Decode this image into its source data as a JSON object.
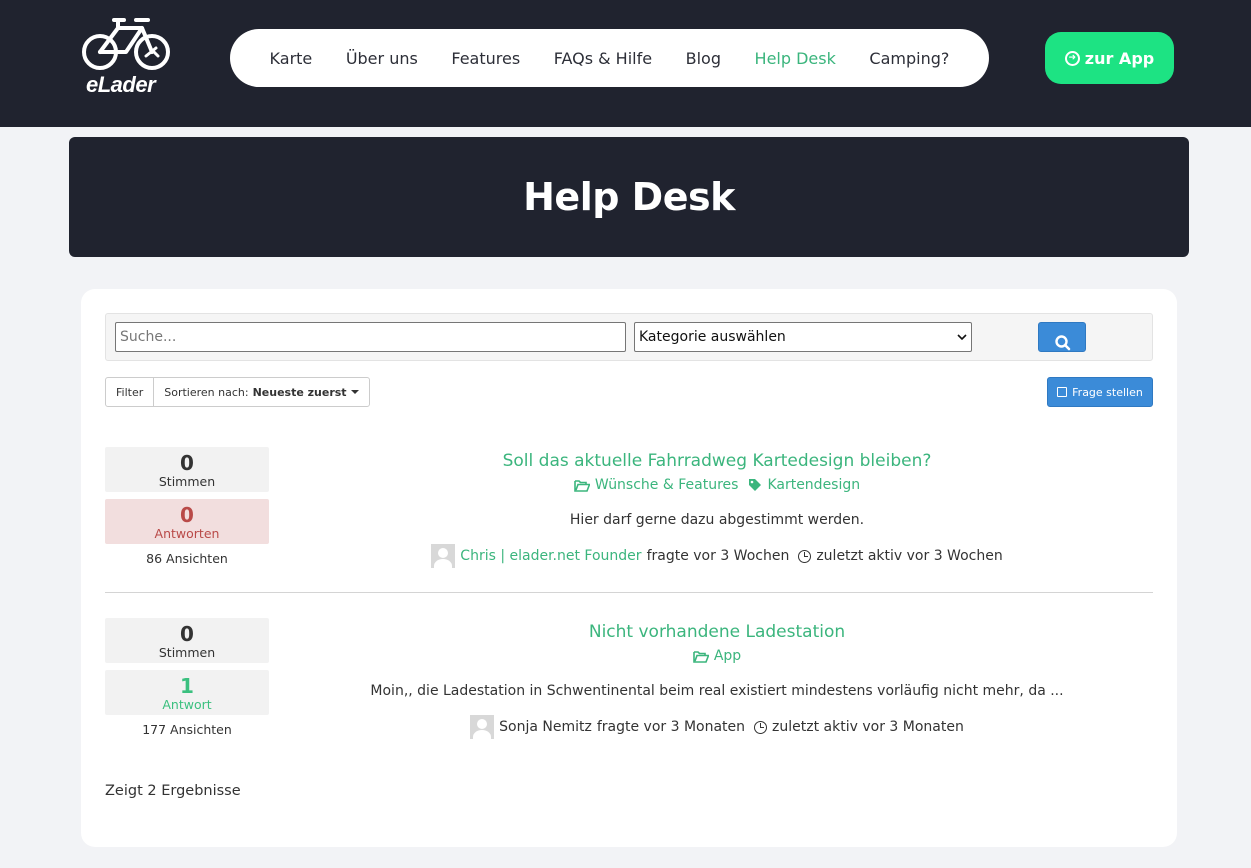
{
  "header": {
    "logo_text": "eLader",
    "nav": [
      {
        "label": "Karte",
        "active": false
      },
      {
        "label": "Über uns",
        "active": false
      },
      {
        "label": "Features",
        "active": false
      },
      {
        "label": "FAQs & Hilfe",
        "active": false
      },
      {
        "label": "Blog",
        "active": false
      },
      {
        "label": "Help Desk",
        "active": true
      },
      {
        "label": "Camping?",
        "active": false
      }
    ],
    "app_button": "zur App",
    "accent_color": "#1de383",
    "active_color": "#3bb57d"
  },
  "hero": {
    "title": "Help Desk"
  },
  "search": {
    "placeholder": "Suche...",
    "category_selected": "Kategorie auswählen"
  },
  "toolbar": {
    "filter_label": "Filter",
    "sort_prefix": "Sortieren nach:",
    "sort_value": "Neueste zuerst",
    "ask_label": "Frage stellen"
  },
  "questions": [
    {
      "votes": "0",
      "votes_label": "Stimmen",
      "answers": "0",
      "answers_label": "Antworten",
      "views": "86 Ansichten",
      "title": "Soll das aktuelle Fahrradweg Kartedesign bleiben?",
      "category": "Wünsche & Features",
      "tag": "Kartendesign",
      "excerpt": "Hier darf gerne dazu abgestimmt werden.",
      "author": "Chris | elader.net Founder",
      "asked": "fragte vor 3 Wochen",
      "last_active": "zuletzt aktiv vor 3 Wochen"
    },
    {
      "votes": "0",
      "votes_label": "Stimmen",
      "answers": "1",
      "answers_label": "Antwort",
      "views": "177 Ansichten",
      "title": "Nicht vorhandene Ladestation",
      "category": "App",
      "excerpt": "Moin,, die Ladestation in Schwentinental beim real existiert mindestens vorläufig nicht mehr, da ...",
      "author": "Sonja Nemitz",
      "asked": "fragte vor 3 Monaten",
      "last_active": "zuletzt aktiv vor 3 Monaten"
    }
  ],
  "footer": {
    "results_text": "Zeigt 2 Ergebnisse"
  }
}
